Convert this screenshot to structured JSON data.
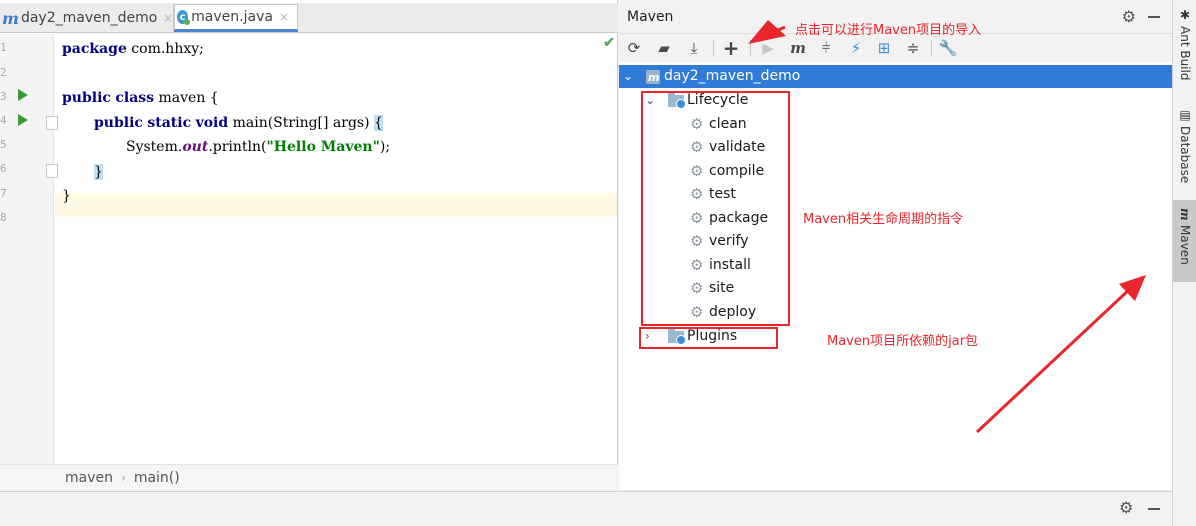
{
  "tabs": [
    {
      "label": "day2_maven_demo",
      "logo": "m"
    },
    {
      "label": "maven.java",
      "logo": "c"
    }
  ],
  "close_glyph": "×",
  "code": {
    "line_numbers": [
      "1",
      "2",
      "3",
      "4",
      "5",
      "6",
      "7",
      "8"
    ],
    "line1": {
      "kw": "package",
      "rest": " com.hhxy;"
    },
    "line3": {
      "kw1": "public",
      "kw2": "class",
      "rest": " maven {"
    },
    "line4": {
      "kw1": "public",
      "kw2": "static",
      "kw3": "void",
      "rest": " main(String[] args) ",
      "brace": "{"
    },
    "line5": {
      "pre": "System.",
      "italic": "out",
      "mid": ".println(",
      "str": "\"Hello Maven\"",
      "post": ");"
    },
    "line6": {
      "brace": "}"
    },
    "line7": {
      "text": "}"
    }
  },
  "breadcrumb": {
    "class_name": "maven",
    "separator": "›",
    "method": "main()"
  },
  "maven": {
    "title": "Maven",
    "project": "day2_maven_demo",
    "lifecycle_label": "Lifecycle",
    "lifecycle_items": [
      "clean",
      "validate",
      "compile",
      "test",
      "package",
      "verify",
      "install",
      "site",
      "deploy"
    ],
    "plugins_label": "Plugins"
  },
  "toolbar": {
    "icons": [
      "reload-icon",
      "generate-sources-icon",
      "download-icon",
      "add-icon",
      "run-icon",
      "execute-goal-icon",
      "toggle-offline-icon",
      "skip-tests-icon",
      "show-dependencies-icon",
      "collapse-all-icon",
      "settings-wrench-icon"
    ],
    "add_glyph": "+"
  },
  "annotations": {
    "import": "点击可以进行Maven项目的导入",
    "lifecycle": "Maven相关生命周期的指令",
    "plugins": "Maven项目所依赖的jar包"
  },
  "right_strip": [
    "Ant Build",
    "Database",
    "Maven"
  ],
  "colors": {
    "accent": "#2f7bd7",
    "annotation_red": "#e8262b",
    "keyword": "#000080",
    "string": "#008000"
  }
}
